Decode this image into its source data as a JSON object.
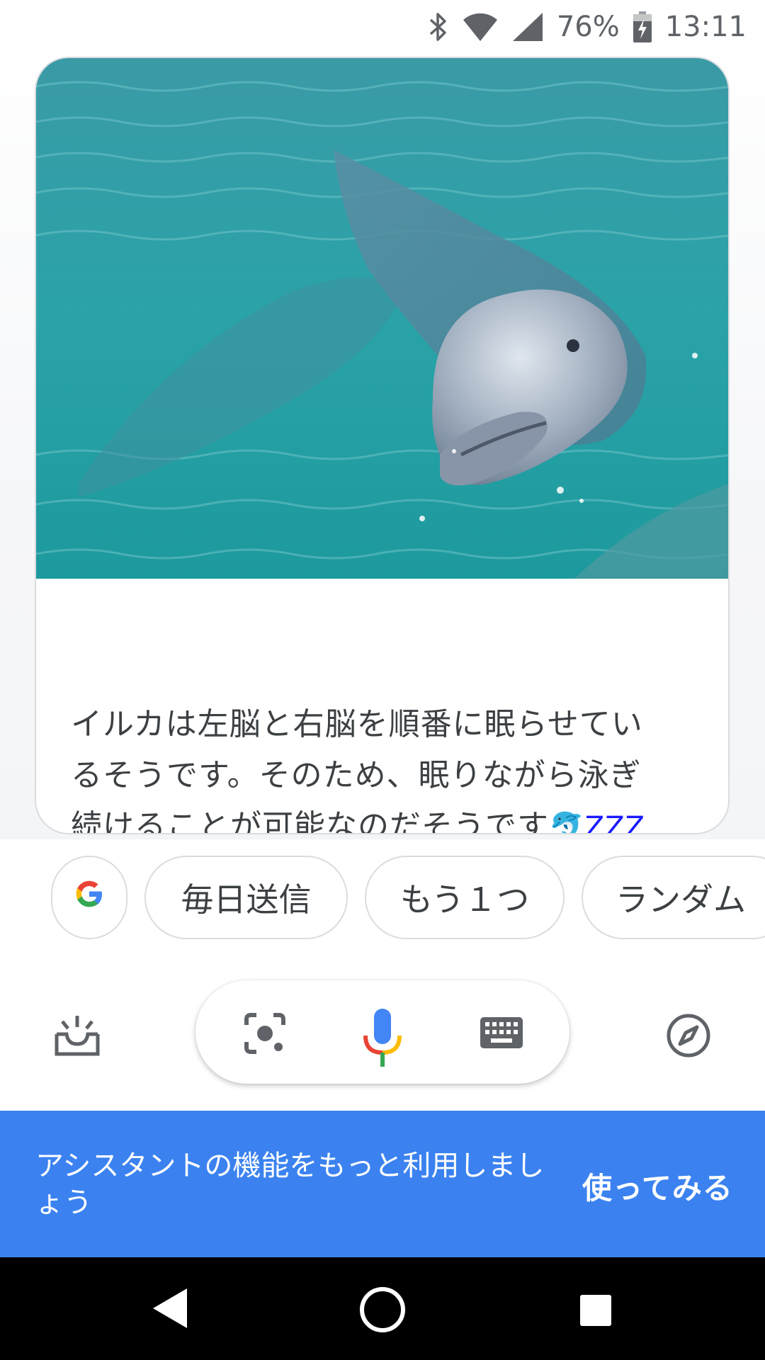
{
  "status_bar": {
    "icons": [
      "bluetooth-icon",
      "wifi-icon",
      "signal-icon",
      "battery-charging-icon"
    ],
    "battery": "76%",
    "time": "13:11"
  },
  "card": {
    "image": "dolphin-photo",
    "text_line1": "イルカは左脳と右脳を順番に眠らせてい",
    "text_line2": "るそうです。そのため、眠りながら泳ぎ",
    "text_line3": "続けることが可能なのだそうです",
    "text_emoji": "🐬ZZZ"
  },
  "chips": {
    "google_icon": "google-icon",
    "chip1": "毎日送信",
    "chip2": "もう１つ",
    "chip3": "ランダム"
  },
  "toolbar": {
    "left_icon": "updates-tray-icon",
    "lens_icon": "lens-icon",
    "mic_icon": "mic-icon",
    "keyboard_icon": "keyboard-icon",
    "right_icon": "compass-icon"
  },
  "banner": {
    "text": "アシスタントの機能をもっと利用しましょう",
    "button": "使ってみる",
    "color": "#3b82f0"
  },
  "nav": {
    "back": "back-icon",
    "home": "home-icon",
    "recent": "recent-apps-icon"
  }
}
